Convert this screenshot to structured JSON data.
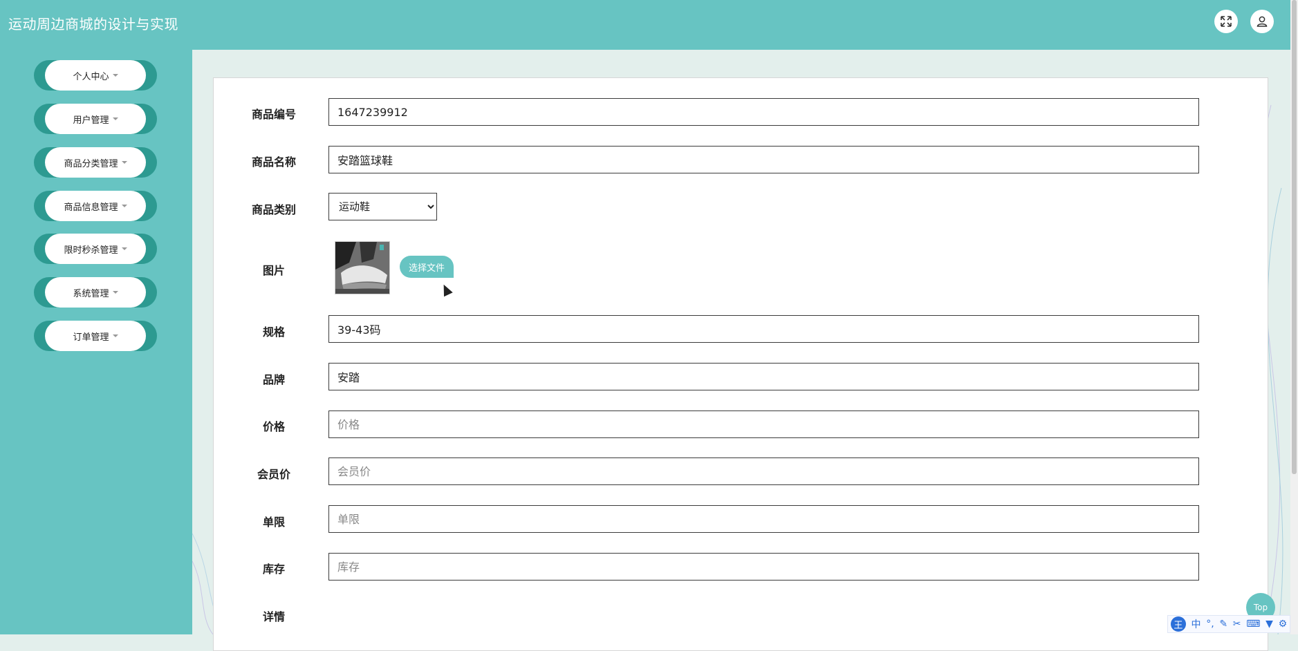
{
  "header": {
    "title": "运动周边商城的设计与实现",
    "fullscreen_icon": "expand-icon",
    "user_icon": "user-icon"
  },
  "sidebar": {
    "items": [
      {
        "label": "个人中心"
      },
      {
        "label": "用户管理"
      },
      {
        "label": "商品分类管理"
      },
      {
        "label": "商品信息管理"
      },
      {
        "label": "限时秒杀管理"
      },
      {
        "label": "系统管理"
      },
      {
        "label": "订单管理"
      }
    ]
  },
  "form": {
    "product_no": {
      "label": "商品编号",
      "value": "1647239912"
    },
    "product_name": {
      "label": "商品名称",
      "value": "安踏篮球鞋"
    },
    "category": {
      "label": "商品类别",
      "value": "运动鞋"
    },
    "image": {
      "label": "图片",
      "button_label": "选择文件"
    },
    "spec": {
      "label": "规格",
      "value": "39-43码"
    },
    "brand": {
      "label": "品牌",
      "value": "安踏"
    },
    "price": {
      "label": "价格",
      "placeholder": "价格"
    },
    "member_price": {
      "label": "会员价",
      "placeholder": "会员价"
    },
    "limit": {
      "label": "单限",
      "placeholder": "单限"
    },
    "stock": {
      "label": "库存",
      "placeholder": "库存"
    },
    "detail": {
      "label": "详情"
    }
  },
  "top_button": {
    "label": "Top"
  },
  "ime": {
    "logo": "王",
    "mode": "中"
  },
  "colors": {
    "accent": "#67c4c2",
    "sidebar_pill_border": "#2d9a91",
    "content_bg": "#e3efec"
  }
}
